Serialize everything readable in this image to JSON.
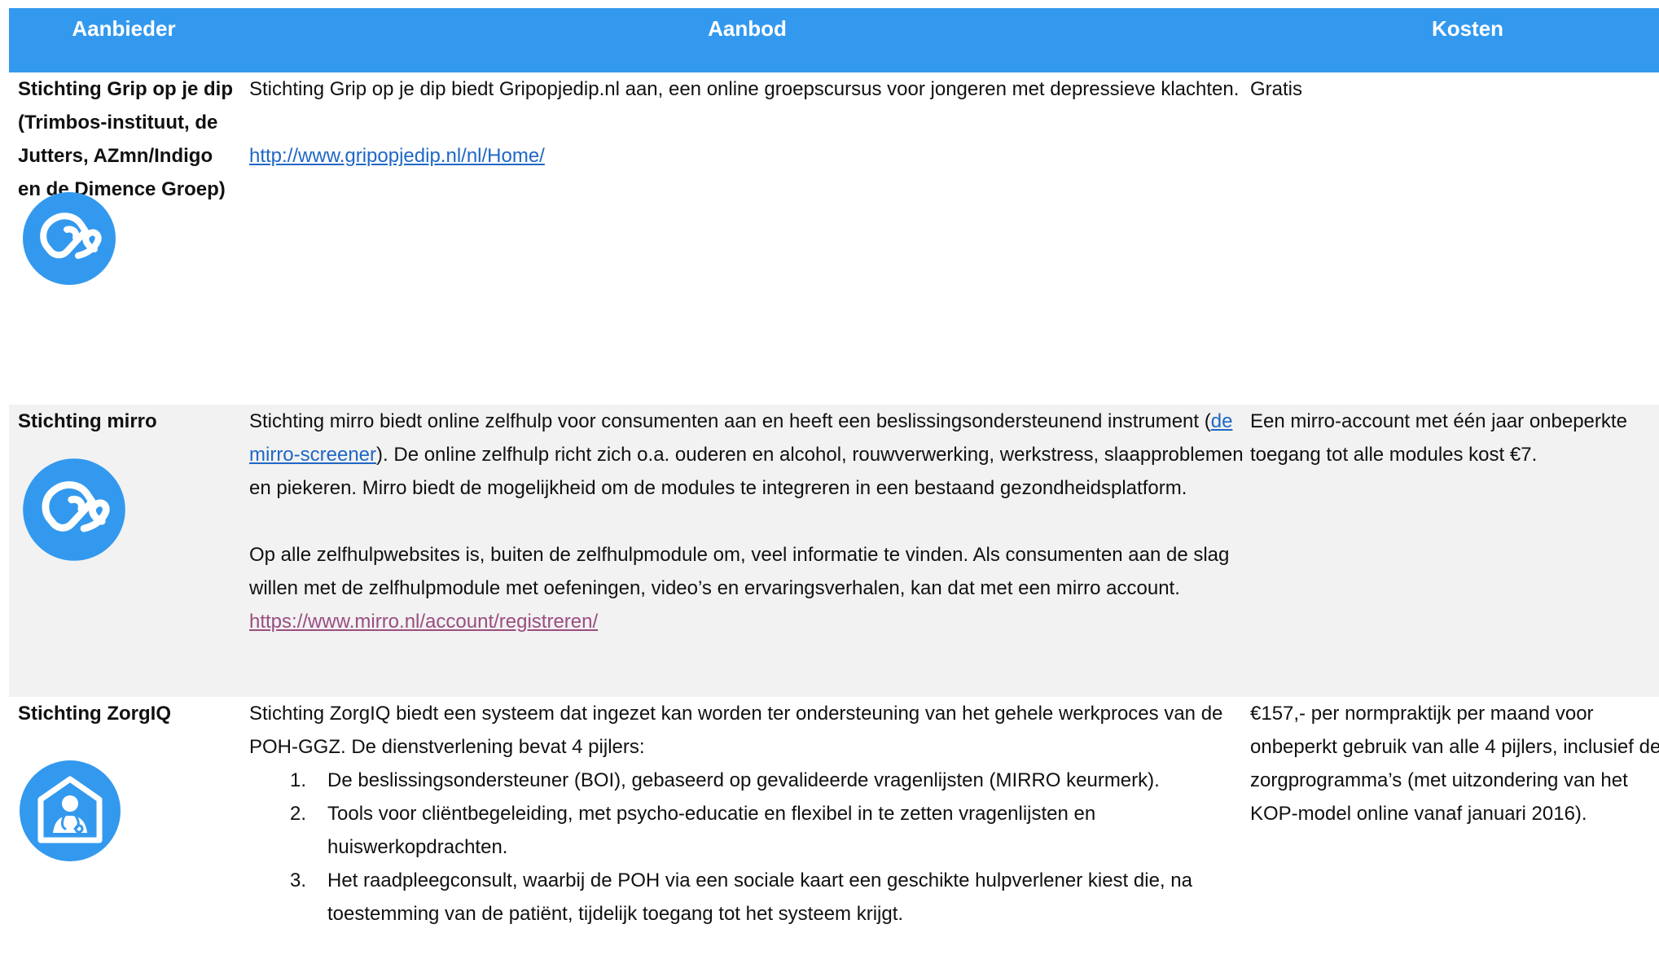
{
  "header": {
    "provider": "Aanbieder",
    "offer": "Aanbod",
    "cost": "Kosten"
  },
  "rows": [
    {
      "provider": "Stichting Grip op je dip (Trimbos-instituut, de Jutters, AZmn/Indigo en de Dimence Groep)",
      "icon": "mouse-icon",
      "offer_text": "Stichting Grip op je dip biedt Gripopjedip.nl aan, een online groepscursus voor jongeren met depressieve klachten.",
      "offer_link": "http://www.gripopjedip.nl/nl/Home/",
      "cost": "Gratis"
    },
    {
      "provider": "Stichting mirro",
      "icon": "mouse-icon",
      "offer_text_before_link": "Stichting mirro biedt online zelfhulp voor consumenten aan en heeft een beslissingsondersteunend instrument (",
      "offer_inline_link": "de mirro-screener",
      "offer_text_after_link": "). De online zelfhulp richt zich o.a. ouderen en alcohol, rouwverwerking, werkstress, slaapproblemen en piekeren. Mirro biedt de mogelijkheid om de modules te integreren in een bestaand gezondheidsplatform.",
      "offer_text_2": "Op alle zelfhulpwebsites is, buiten de zelfhulpmodule om, veel informatie te vinden. Als consumenten aan de slag willen met de zelfhulpmodule met oefeningen, video’s en ervaringsverhalen, kan dat met een mirro account.",
      "offer_link_2": "https://www.mirro.nl/account/registreren/",
      "cost": "Een mirro-account met één jaar onbeperkte toegang tot alle modules kost €7."
    },
    {
      "provider": "Stichting ZorgIQ",
      "icon": "home-doctor-icon",
      "offer_intro": "Stichting ZorgIQ biedt een systeem dat ingezet kan worden ter ondersteuning van het gehele werkproces van de POH-GGZ. De dienstverlening bevat 4 pijlers:",
      "pillars": [
        {
          "num": "1.",
          "text": "De beslissingsondersteuner (BOI), gebaseerd op gevalideerde vragenlijsten (MIRRO keurmerk)."
        },
        {
          "num": "2.",
          "text": "Tools voor cliëntbegeleiding, met psycho-educatie en flexibel in te zetten vragenlijsten en huiswerkopdrachten."
        },
        {
          "num": "3.",
          "text": "Het raadpleegconsult, waarbij de POH via een sociale kaart een geschikte hulpverlener kiest die, na toestemming van de patiënt, tijdelijk toegang tot het systeem krijgt."
        }
      ],
      "cost": "€157,- per normpraktijk per maand voor onbeperkt gebruik van alle 4 pijlers, inclusief de zorgprogramma’s (met uitzondering van het KOP-model online vanaf januari 2016)."
    }
  ],
  "colors": {
    "header_bg": "#3399ee",
    "header_text": "#ffffff",
    "row_alt_bg": "#f2f2f2",
    "link": "#1f67c6",
    "visited_link": "#9a4d80",
    "icon_bg": "#3399ee"
  }
}
